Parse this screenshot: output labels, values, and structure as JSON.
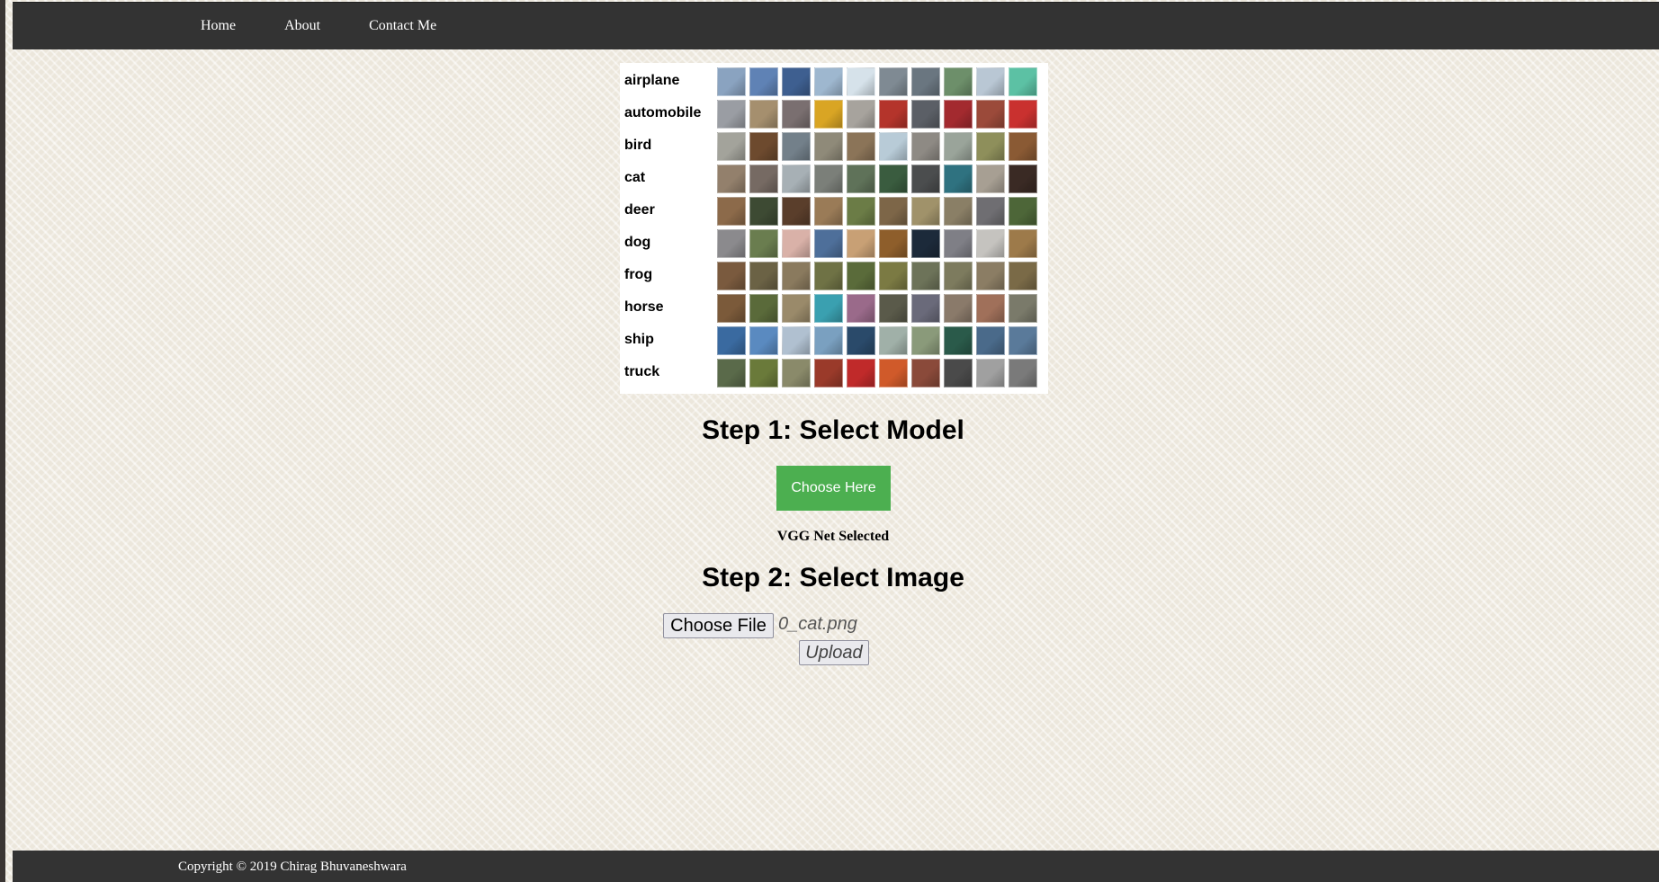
{
  "nav": {
    "items": [
      "Home",
      "About",
      "Contact Me"
    ]
  },
  "dataset_grid": {
    "classes": [
      {
        "label": "airplane",
        "colors": [
          "#8aa3c0",
          "#5f82b5",
          "#3e5f90",
          "#9eb7cf",
          "#d6e2ea",
          "#7f8a93",
          "#6a7680",
          "#6d8f6a",
          "#b9c7d4",
          "#5cc1a4"
        ]
      },
      {
        "label": "automobile",
        "colors": [
          "#9a9da3",
          "#a58f6e",
          "#7a6f70",
          "#d9a524",
          "#a7a39d",
          "#b4342b",
          "#5b5f66",
          "#a32a2f",
          "#9b4a3a",
          "#c9312f"
        ]
      },
      {
        "label": "bird",
        "colors": [
          "#a3a39b",
          "#6d4a2e",
          "#73808a",
          "#8f8a79",
          "#8b7458",
          "#b8cbd7",
          "#8e8a84",
          "#9aa49a",
          "#8e8f5b",
          "#8a5a34"
        ]
      },
      {
        "label": "cat",
        "colors": [
          "#93806c",
          "#766a63",
          "#a7b0b5",
          "#7b7f79",
          "#5f7259",
          "#3a5c3f",
          "#4b4d4e",
          "#2f7280",
          "#a79f93",
          "#3a2a24"
        ]
      },
      {
        "label": "deer",
        "colors": [
          "#8c6a4a",
          "#3d4a33",
          "#5a3e2b",
          "#9a7b57",
          "#6b7c46",
          "#7d6648",
          "#a0926a",
          "#8a7f66",
          "#6f6e72",
          "#4d6638"
        ]
      },
      {
        "label": "dog",
        "colors": [
          "#8b8a8d",
          "#6a7d4f",
          "#d9b1a8",
          "#4e6f9a",
          "#c8a075",
          "#8e5e2b",
          "#1c2a3a",
          "#7f7f86",
          "#c5c3bf",
          "#9d7a4a"
        ]
      },
      {
        "label": "frog",
        "colors": [
          "#7a5a3e",
          "#6b6245",
          "#8a7a5e",
          "#6f7245",
          "#5a6b3a",
          "#7b7a43",
          "#6d7359",
          "#7d7b5e",
          "#8b7d64",
          "#7a6a47"
        ]
      },
      {
        "label": "horse",
        "colors": [
          "#7b5a3a",
          "#5a6a3a",
          "#9a8a6a",
          "#3aa0b0",
          "#9a6a8a",
          "#5a5a4a",
          "#6a6a7a",
          "#8a7a6a",
          "#a0705a",
          "#7a7a6a"
        ]
      },
      {
        "label": "ship",
        "colors": [
          "#3a6aa0",
          "#5a8ac0",
          "#b0c0d0",
          "#7aa0c0",
          "#2a4a6a",
          "#a0b0a8",
          "#8a9a7a",
          "#2a5a4a",
          "#4a6a8a",
          "#5a7a9a"
        ]
      },
      {
        "label": "truck",
        "colors": [
          "#5a6a4a",
          "#6a7a3a",
          "#8a8a6a",
          "#9a3a2a",
          "#c02a2a",
          "#d05a2a",
          "#8a4a3a",
          "#4a4a4a",
          "#a0a0a0",
          "#7a7a7a"
        ]
      }
    ]
  },
  "step1": {
    "heading": "Step 1: Select Model",
    "button_label": "Choose Here",
    "status": "VGG Net Selected",
    "button_color": "#4caf50"
  },
  "step2": {
    "heading": "Step 2: Select Image",
    "file_button_label": "Choose File",
    "file_name": "0_cat.png",
    "upload_label": "Upload"
  },
  "footer": {
    "copyright": "Copyright © 2019 Chirag Bhuvaneshwara"
  }
}
